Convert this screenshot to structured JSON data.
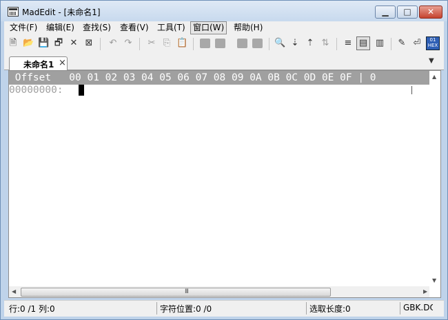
{
  "window": {
    "title": "MadEdit - [未命名1]",
    "minimize": "▁",
    "maximize": "□",
    "close": "✕"
  },
  "menu": [
    {
      "label": "文件(F)"
    },
    {
      "label": "编辑(E)"
    },
    {
      "label": "查找(S)"
    },
    {
      "label": "查看(V)"
    },
    {
      "label": "工具(T)"
    },
    {
      "label": "窗口(W)"
    },
    {
      "label": "帮助(H)"
    }
  ],
  "toolbar": {
    "new": "🗎",
    "open": "📂",
    "save": "💾",
    "save_all": "🗗",
    "close": "✕",
    "close_all": "⊠",
    "undo": "↶",
    "redo": "↷",
    "cut": "✂",
    "copy": "⎘",
    "paste": "📋",
    "find": "🔍",
    "find_next": "⇣",
    "find_prev": "⇡",
    "find_hex": "⇅",
    "text_mode": "≡",
    "column_mode": "▤",
    "hex_mode": "▥",
    "edit": "✎",
    "wrap": "⏎",
    "hex_view_label": "01\nHEX"
  },
  "tab": {
    "label": "未命名1",
    "close": "×",
    "menu": "▼"
  },
  "editor": {
    "header": " Offset   00 01 02 03 04 05 06 07 08 09 0A 0B 0C 0D 0E 0F | 0",
    "first_row": "00000000:"
  },
  "scroll": {
    "up": "▲",
    "down": "▼",
    "left": "◀",
    "right": "▶",
    "grip": "III"
  },
  "status": {
    "line_col": "行:0 /1 列:0",
    "char_pos": "字符位置:0 /0",
    "selection": "选取长度:0",
    "encoding": "GBK.DO"
  }
}
